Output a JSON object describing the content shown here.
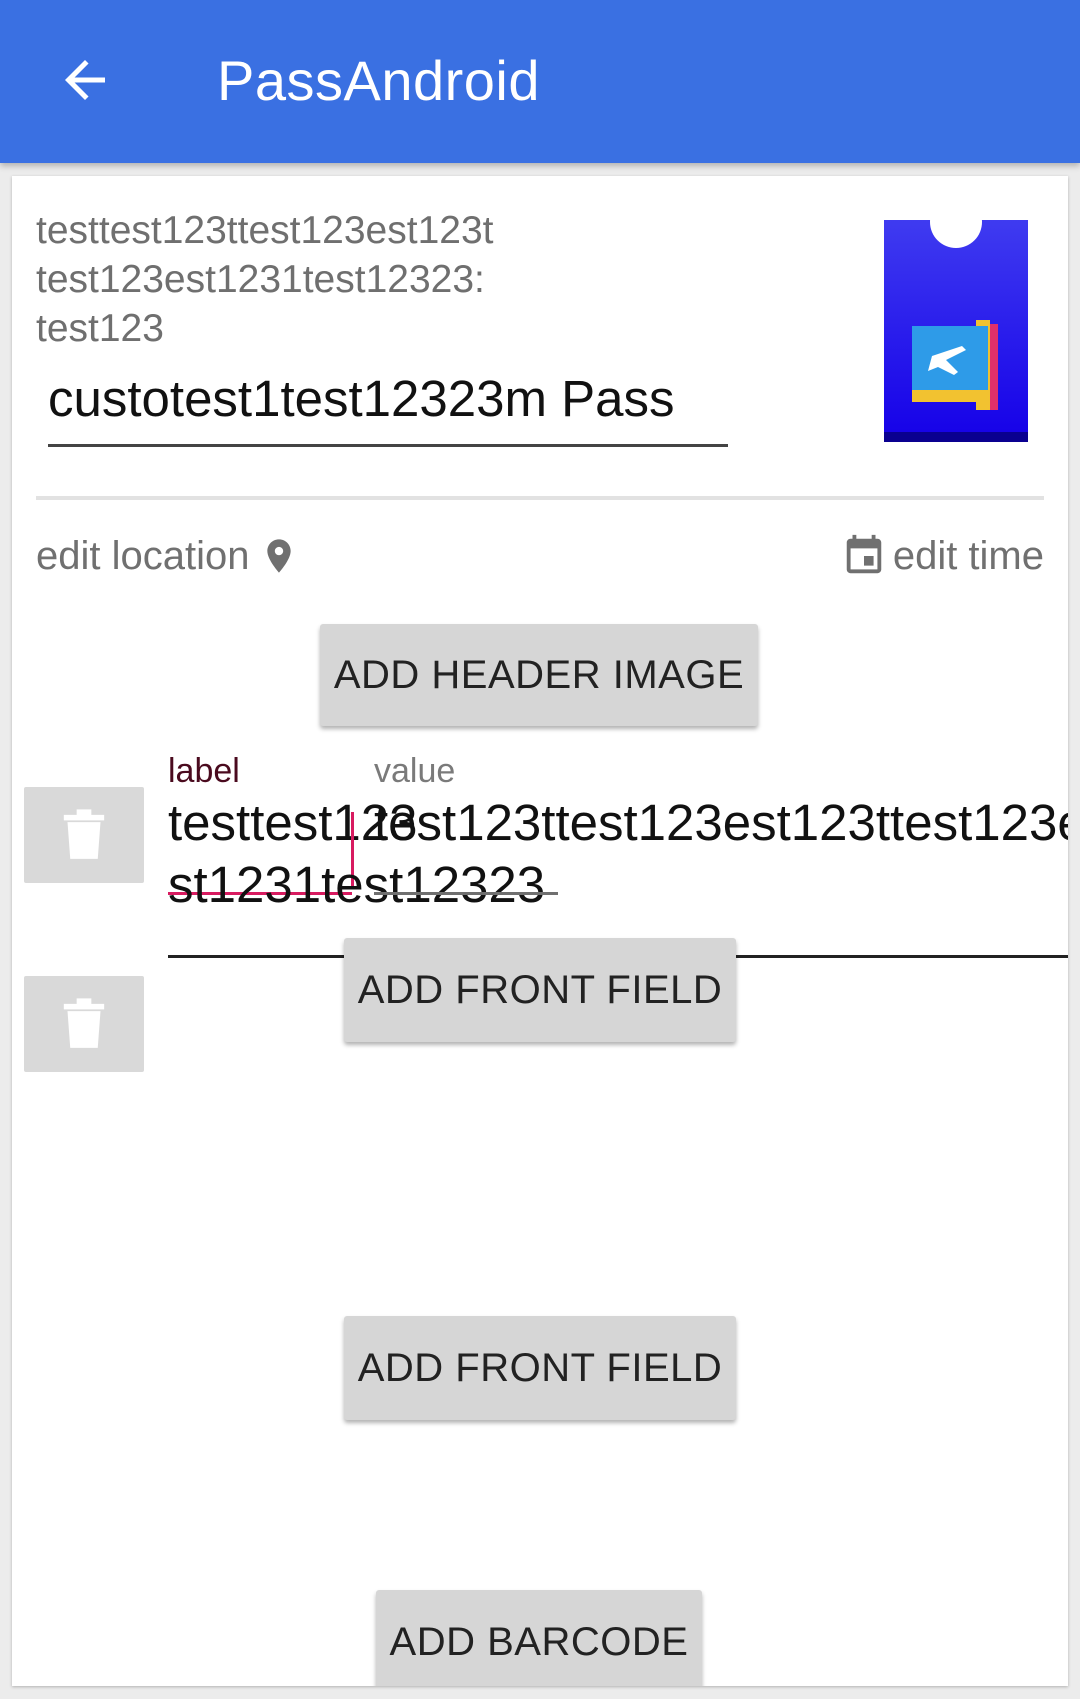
{
  "appbar": {
    "title": "PassAndroid",
    "back_icon": "arrow-back-icon",
    "color": "#3a70e2"
  },
  "pass": {
    "description": [
      "testtest123ttest123est123t",
      "test123est1231test12323:",
      "test123"
    ],
    "name_value": "custotest1test12323m Pass",
    "icon": "boarding-pass-plane-icon",
    "edit_location_label": "edit location",
    "edit_time_label": "edit time"
  },
  "buttons": {
    "add_header_image": "ADD HEADER IMAGE",
    "add_front_field_1": "ADD FRONT FIELD",
    "add_front_field_2": "ADD FRONT FIELD",
    "add_barcode": "ADD BARCODE"
  },
  "field": {
    "label_caption": "label",
    "value_caption": "value",
    "label_value": "testtest123",
    "value_value_line1": "test123ttest123est123ttest123e",
    "value_value_line2": "st1231test12323",
    "accent_color": "#d81b60"
  }
}
